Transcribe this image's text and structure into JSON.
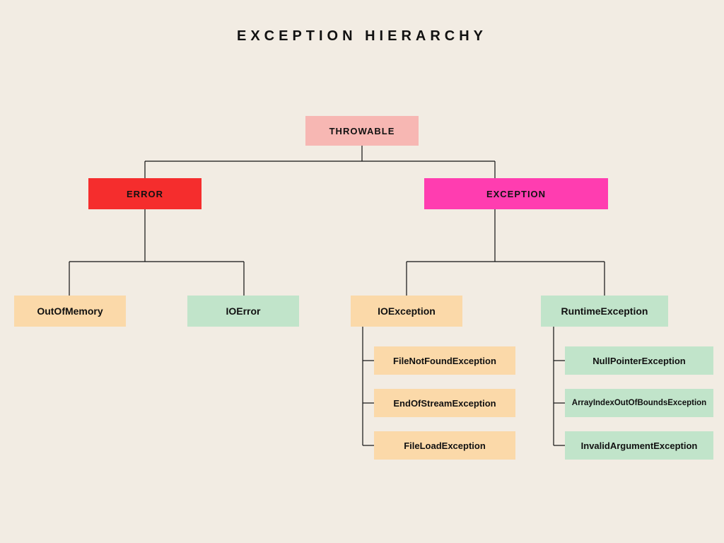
{
  "title": "EXCEPTION HIERARCHY",
  "nodes": {
    "throwable": "THROWABLE",
    "error": "ERROR",
    "exception": "EXCEPTION",
    "outofmemory": "OutOfMemory",
    "ioerror": "IOError",
    "ioexception": "IOException",
    "runtimeexception": "RuntimeException",
    "filenotfound": "FileNotFoundException",
    "endofstream": "EndOfStreamException",
    "fileload": "FileLoadException",
    "nullpointer": "NullPointerException",
    "arrayindex": "ArrayIndexOutOfBoundsException",
    "invalidarg": "InvalidArgumentException"
  },
  "colors": {
    "bg": "#f2ece3",
    "pink": "#f7b7b3",
    "red": "#f52d2d",
    "magenta": "#ff3db0",
    "peach": "#fbd9a9",
    "mint": "#c1e4ca"
  },
  "chart_data": {
    "type": "hierarchy",
    "title": "EXCEPTION HIERARCHY",
    "root": {
      "name": "THROWABLE",
      "color": "pink",
      "children": [
        {
          "name": "ERROR",
          "color": "red",
          "children": [
            {
              "name": "OutOfMemory",
              "color": "peach"
            },
            {
              "name": "IOError",
              "color": "mint"
            }
          ]
        },
        {
          "name": "EXCEPTION",
          "color": "magenta",
          "children": [
            {
              "name": "IOException",
              "color": "peach",
              "children": [
                {
                  "name": "FileNotFoundException",
                  "color": "peach"
                },
                {
                  "name": "EndOfStreamException",
                  "color": "peach"
                },
                {
                  "name": "FileLoadException",
                  "color": "peach"
                }
              ]
            },
            {
              "name": "RuntimeException",
              "color": "mint",
              "children": [
                {
                  "name": "NullPointerException",
                  "color": "mint"
                },
                {
                  "name": "ArrayIndexOutOfBoundsException",
                  "color": "mint"
                },
                {
                  "name": "InvalidArgumentException",
                  "color": "mint"
                }
              ]
            }
          ]
        }
      ]
    }
  }
}
